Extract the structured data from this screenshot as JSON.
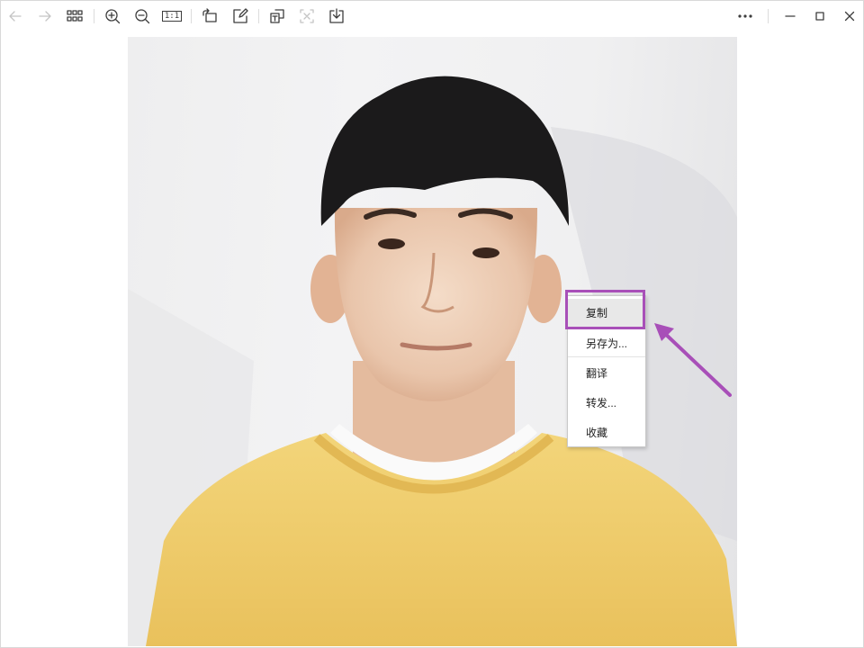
{
  "toolbar": {
    "back": {
      "icon": "back-arrow-icon",
      "enabled": false
    },
    "forward": {
      "icon": "forward-arrow-icon",
      "enabled": false
    },
    "grid_view": {
      "icon": "grid-icon"
    },
    "zoom_in": {
      "icon": "zoom-in-icon"
    },
    "zoom_out": {
      "icon": "zoom-out-icon"
    },
    "actual_size_label": "1:1",
    "rotate": {
      "icon": "rotate-icon"
    },
    "edit": {
      "icon": "edit-icon"
    },
    "translate": {
      "icon": "translate-icon"
    },
    "scan": {
      "icon": "scan-icon",
      "enabled": false
    },
    "download": {
      "icon": "download-icon"
    },
    "more": {
      "icon": "more-icon"
    },
    "window_controls": [
      "minimize-icon",
      "maximize-icon",
      "close-icon"
    ]
  },
  "image": {
    "description_icon": "portrait-photo"
  },
  "context_menu": {
    "items": [
      {
        "label": "复制",
        "highlighted": true
      },
      {
        "label": "另存为..."
      },
      {
        "label": "翻译"
      },
      {
        "label": "转发..."
      },
      {
        "label": "收藏"
      }
    ]
  },
  "annotation": {
    "color": "#a84fb8"
  }
}
